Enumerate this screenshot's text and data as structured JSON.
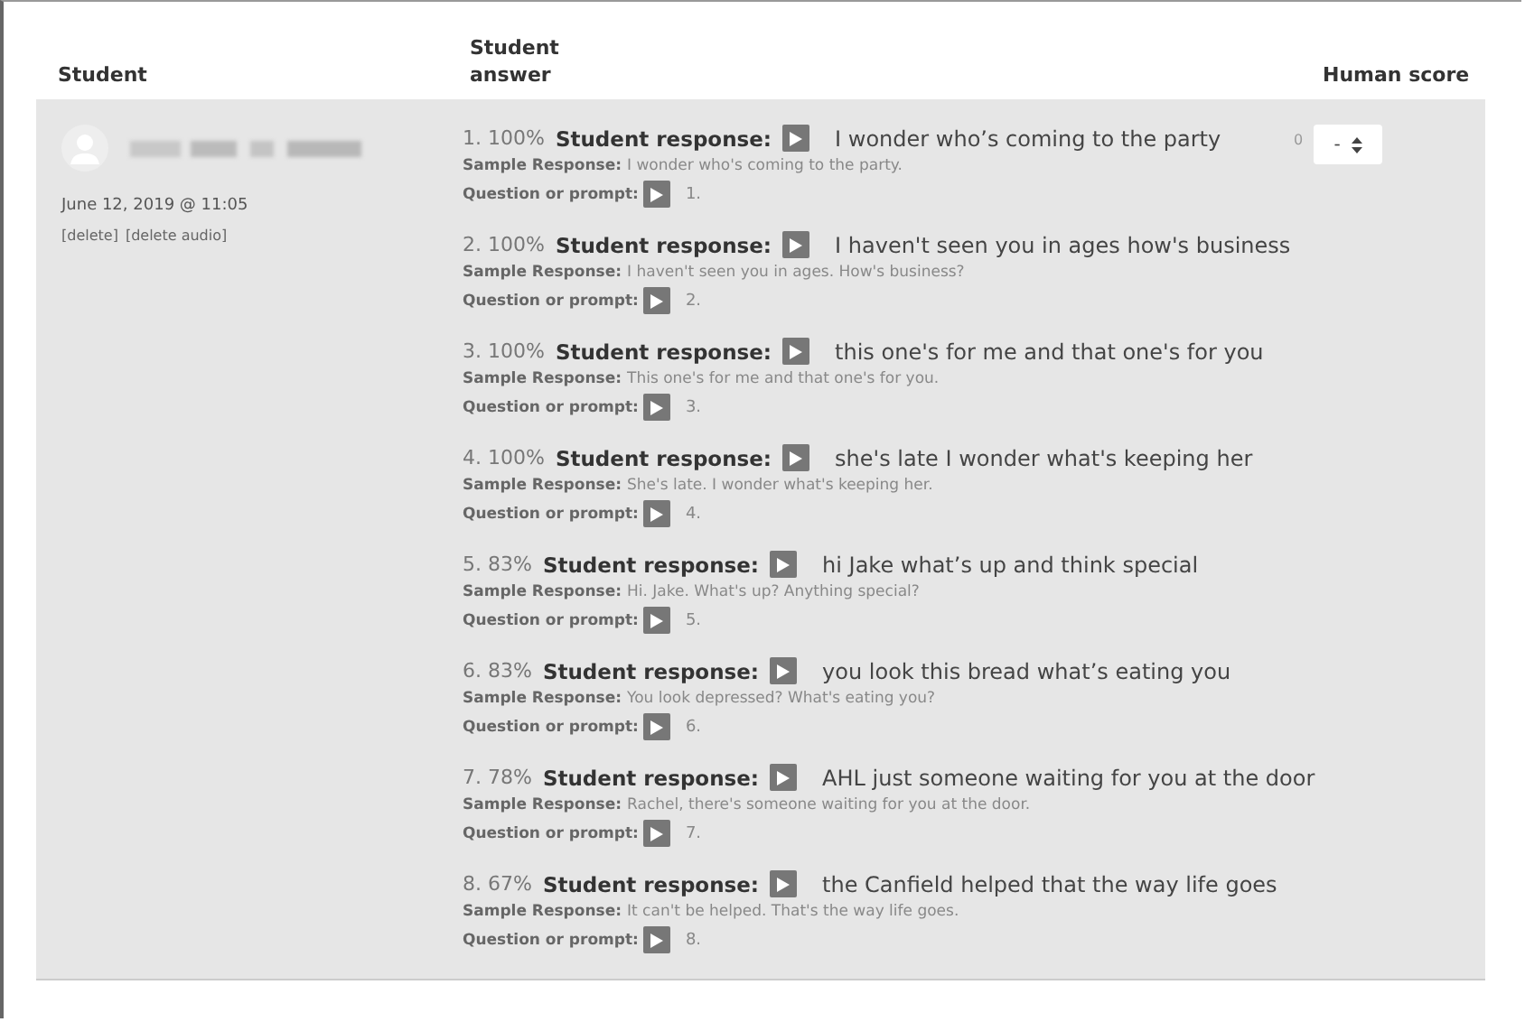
{
  "table": {
    "columns": [
      "Student",
      "Student answer",
      "Human score"
    ],
    "rows": [
      {
        "student": {
          "date": "June 12, 2019 @ 11:05",
          "links": [
            "[delete]",
            "[delete audio]"
          ]
        },
        "answers": [
          {
            "number": "1.",
            "percent": "100%",
            "response_label": "Student response:",
            "response": "I wonder who’s coming to the party",
            "sample_label": "Sample Response:",
            "sample": "I wonder who's coming to the party.",
            "prompt_label": "Question or prompt:",
            "prompt": "1."
          },
          {
            "number": "2.",
            "percent": "100%",
            "response_label": "Student response:",
            "response": "I haven't seen you in ages how's business",
            "sample_label": "Sample Response:",
            "sample": "I haven't seen you in ages. How's business?",
            "prompt_label": "Question or prompt:",
            "prompt": "2."
          },
          {
            "number": "3.",
            "percent": "100%",
            "response_label": "Student response:",
            "response": "this one's for me and that one's for you",
            "sample_label": "Sample Response:",
            "sample": "This one's for me and that one's for you.",
            "prompt_label": "Question or prompt:",
            "prompt": "3."
          },
          {
            "number": "4.",
            "percent": "100%",
            "response_label": "Student response:",
            "response": "she's late I wonder what's keeping her",
            "sample_label": "Sample Response:",
            "sample": "She's late. I wonder what's keeping her.",
            "prompt_label": "Question or prompt:",
            "prompt": "4."
          },
          {
            "number": "5.",
            "percent": "83%",
            "response_label": "Student response:",
            "response": "hi Jake what’s up and think special",
            "sample_label": "Sample Response:",
            "sample": "Hi. Jake. What's up? Anything special?",
            "prompt_label": "Question or prompt:",
            "prompt": "5."
          },
          {
            "number": "6.",
            "percent": "83%",
            "response_label": "Student response:",
            "response": "you look this bread what’s eating you",
            "sample_label": "Sample Response:",
            "sample": "You look depressed? What's eating you?",
            "prompt_label": "Question or prompt:",
            "prompt": "6."
          },
          {
            "number": "7.",
            "percent": "78%",
            "response_label": "Student response:",
            "response": "AHL just someone waiting for you at the door",
            "sample_label": "Sample Response:",
            "sample": "Rachel, there's someone waiting for you at the door.",
            "prompt_label": "Question or prompt:",
            "prompt": "7."
          },
          {
            "number": "8.",
            "percent": "67%",
            "response_label": "Student response:",
            "response": "the Canfield helped that the way life goes",
            "sample_label": "Sample Response:",
            "sample": "It can't be helped. That's the way life goes.",
            "prompt_label": "Question or prompt:",
            "prompt": "8."
          }
        ],
        "score": {
          "label": "0",
          "value": "-"
        }
      }
    ]
  }
}
